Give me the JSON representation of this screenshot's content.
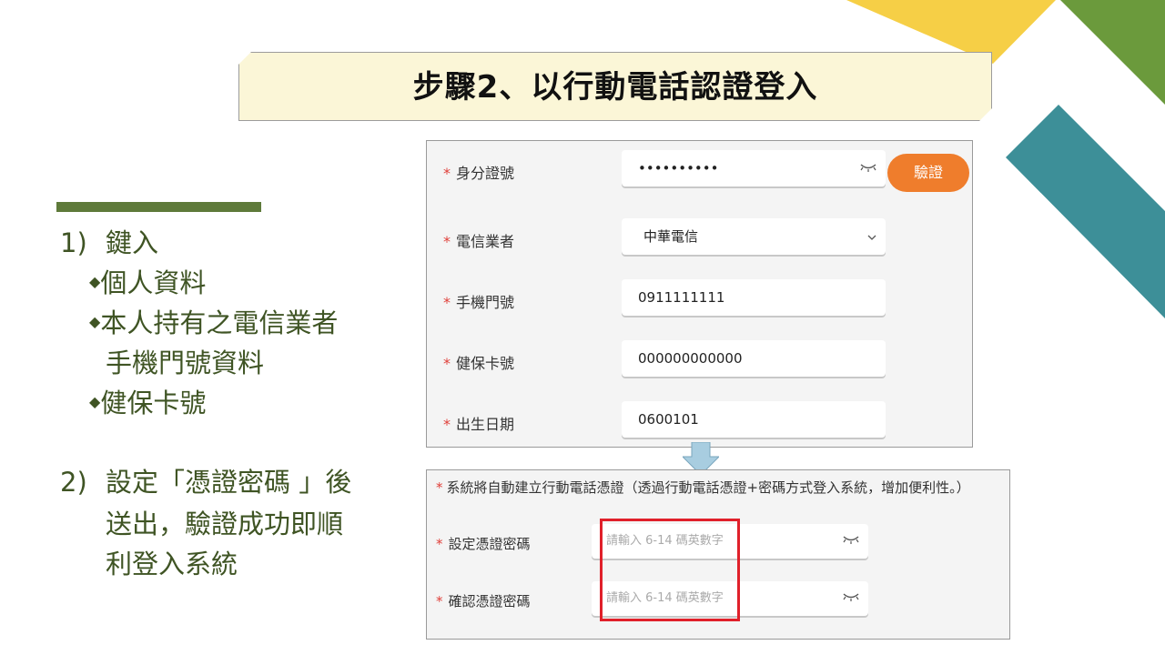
{
  "title": "步驟2、以行動電話認證登入",
  "steps": {
    "step1": {
      "num": "1)",
      "label": "鍵入",
      "bullets": [
        "個人資料",
        "本人持有之電信業者",
        "手機門號資料",
        "健保卡號"
      ]
    },
    "step2": {
      "num": "2)",
      "lines": [
        "設定「憑證密碼 」後",
        "送出，驗證成功即順",
        "利登入系統"
      ]
    }
  },
  "form": {
    "id_label": "身分證號",
    "id_value": "••••••••••",
    "verify_label": "驗證",
    "carrier_label": "電信業者",
    "carrier_value": "中華電信",
    "phone_label": "手機門號",
    "phone_value": "0911111111",
    "nhi_label": "健保卡號",
    "nhi_value": "000000000000",
    "birth_label": "出生日期",
    "birth_value": "0600101"
  },
  "password_form": {
    "notice": "系統將自動建立行動電話憑證（透過行動電話憑證+密碼方式登入系統，增加便利性。）",
    "set_label": "設定憑證密碼",
    "set_placeholder": "請輸入 6-14 碼英數字",
    "confirm_label": "確認憑證密碼",
    "confirm_placeholder": "請輸入 6-14 碼英數字"
  },
  "required_mark": "*",
  "bullet_mark": "◆",
  "colors": {
    "accent_orange": "#ef7d2c",
    "highlight_red": "#e0202a",
    "text_green": "#3f5424",
    "banner_bg": "#fbf6d7"
  }
}
